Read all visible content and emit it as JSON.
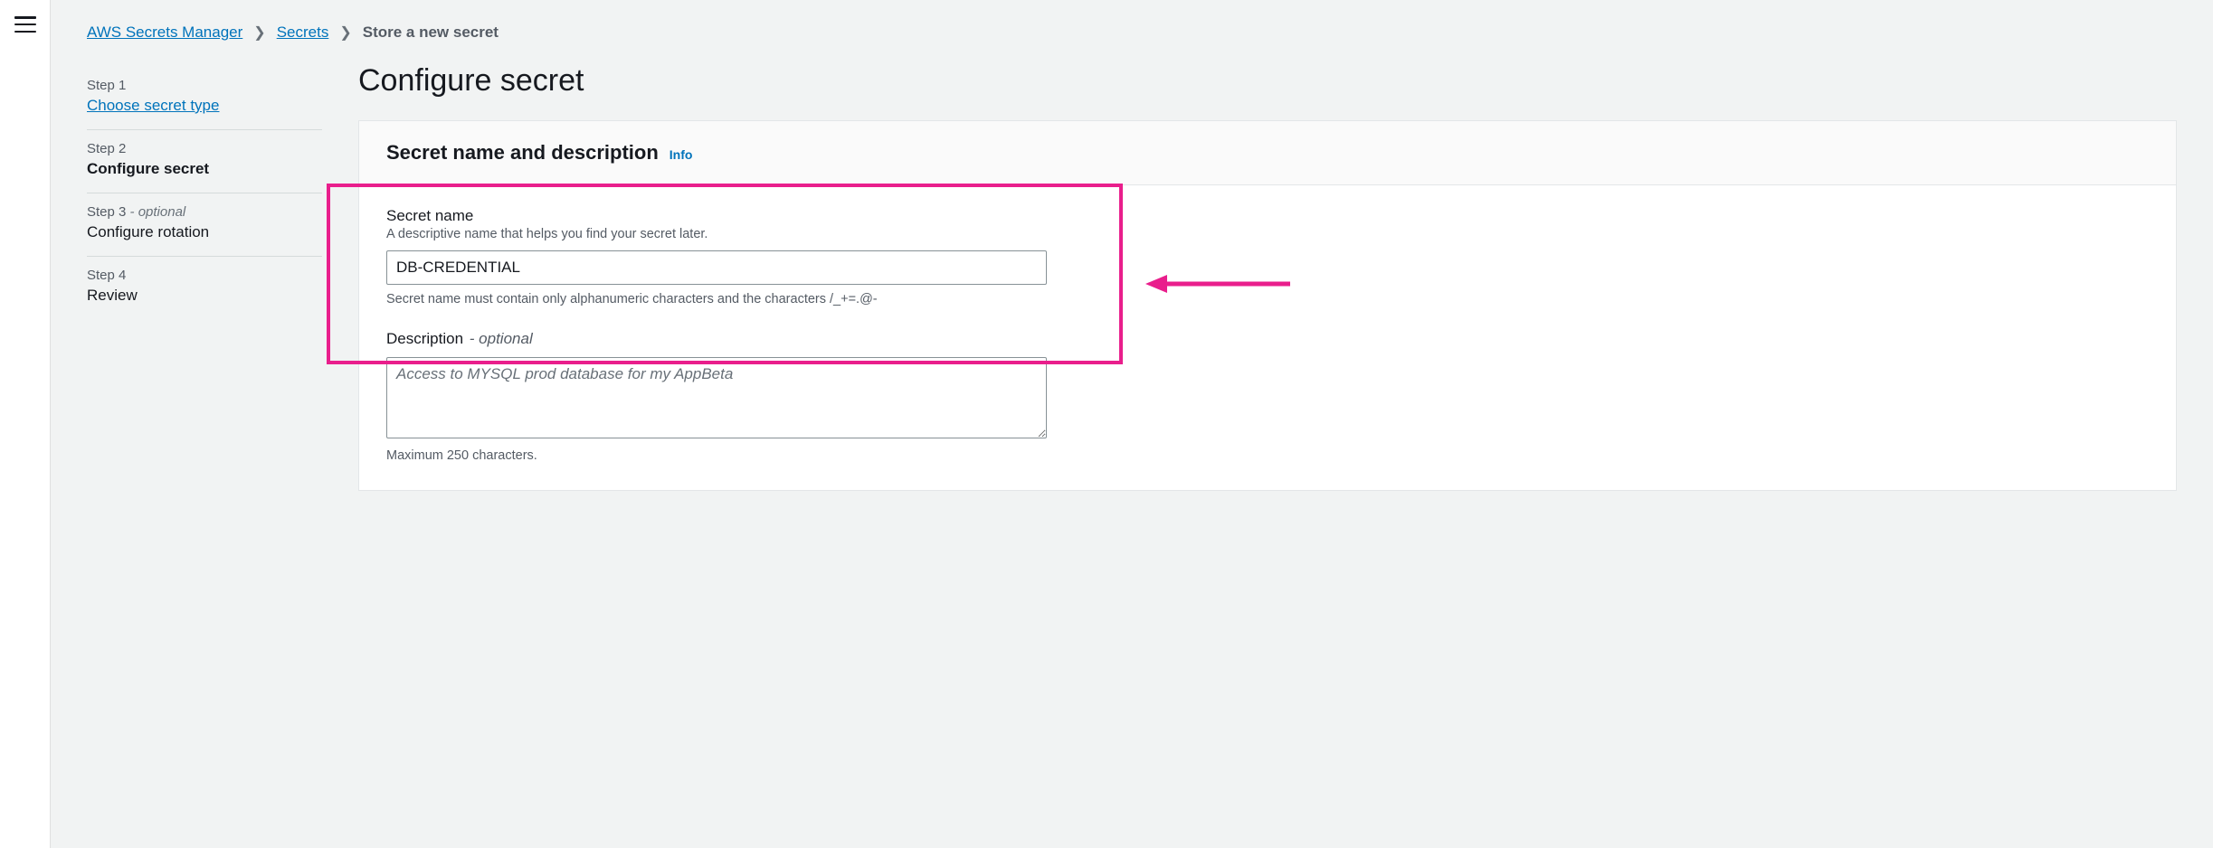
{
  "breadcrumb": {
    "root": "AWS Secrets Manager",
    "parent": "Secrets",
    "current": "Store a new secret"
  },
  "steps": [
    {
      "label": "Step 1",
      "name": "Choose secret type",
      "link": true,
      "active": false,
      "optional": false
    },
    {
      "label": "Step 2",
      "name": "Configure secret",
      "link": false,
      "active": true,
      "optional": false
    },
    {
      "label": "Step 3",
      "name": "Configure rotation",
      "link": false,
      "active": false,
      "optional": true
    },
    {
      "label": "Step 4",
      "name": "Review",
      "link": false,
      "active": false,
      "optional": false
    }
  ],
  "optional_suffix": " - optional",
  "page": {
    "title": "Configure secret"
  },
  "panel": {
    "heading": "Secret name and description",
    "info": "Info"
  },
  "secret_name": {
    "label": "Secret name",
    "helper": "A descriptive name that helps you find your secret later.",
    "value": "DB-CREDENTIAL",
    "constraint": "Secret name must contain only alphanumeric characters and the characters /_+=.@-"
  },
  "description": {
    "label": "Description",
    "optional_text": "- optional",
    "placeholder": "Access to MYSQL prod database for my AppBeta",
    "value": "",
    "constraint": "Maximum 250 characters."
  }
}
